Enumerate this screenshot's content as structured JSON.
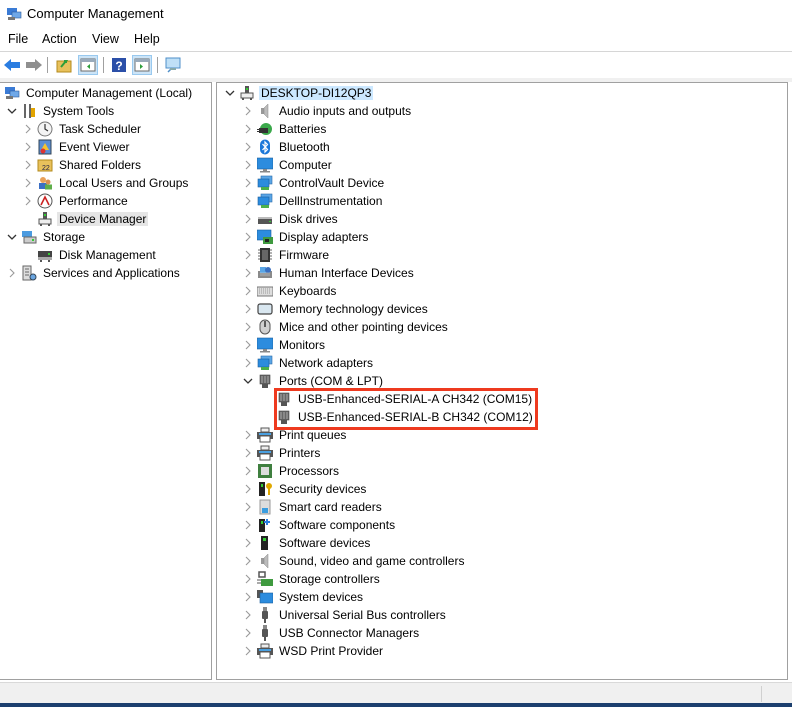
{
  "window": {
    "title": "Computer Management"
  },
  "menu": [
    "File",
    "Action",
    "View",
    "Help"
  ],
  "toolbar": [
    {
      "name": "back-icon"
    },
    {
      "name": "forward-icon"
    },
    {
      "name": "up-folder-icon"
    },
    {
      "name": "show-hide-console-tree-icon",
      "active": true
    },
    {
      "name": "help-icon"
    },
    {
      "name": "show-hide-action-pane-icon",
      "active": true
    },
    {
      "name": "connect-computer-icon"
    }
  ],
  "left_tree": [
    {
      "label": "Computer Management (Local)",
      "level": 0,
      "chevron": "",
      "icon": "computer-management-icon"
    },
    {
      "label": "System Tools",
      "level": 1,
      "chevron": "expanded",
      "icon": "system-tools-icon"
    },
    {
      "label": "Task Scheduler",
      "level": 2,
      "chevron": "collapsed",
      "icon": "task-scheduler-icon"
    },
    {
      "label": "Event Viewer",
      "level": 2,
      "chevron": "collapsed",
      "icon": "event-viewer-icon"
    },
    {
      "label": "Shared Folders",
      "level": 2,
      "chevron": "collapsed",
      "icon": "shared-folders-icon"
    },
    {
      "label": "Local Users and Groups",
      "level": 2,
      "chevron": "collapsed",
      "icon": "local-users-icon"
    },
    {
      "label": "Performance",
      "level": 2,
      "chevron": "collapsed",
      "icon": "performance-icon"
    },
    {
      "label": "Device Manager",
      "level": 2,
      "chevron": "",
      "icon": "device-manager-icon",
      "selected": true
    },
    {
      "label": "Storage",
      "level": 1,
      "chevron": "expanded",
      "icon": "storage-icon"
    },
    {
      "label": "Disk Management",
      "level": 2,
      "chevron": "",
      "icon": "disk-management-icon"
    },
    {
      "label": "Services and Applications",
      "level": 1,
      "chevron": "collapsed",
      "icon": "services-applications-icon"
    }
  ],
  "device_tree": {
    "root": "DESKTOP-DI12QP3",
    "categories": [
      {
        "label": "Audio inputs and outputs",
        "icon": "speaker-icon"
      },
      {
        "label": "Batteries",
        "icon": "battery-icon"
      },
      {
        "label": "Bluetooth",
        "icon": "bluetooth-icon"
      },
      {
        "label": "Computer",
        "icon": "monitor-icon"
      },
      {
        "label": "ControlVault Device",
        "icon": "network-icon"
      },
      {
        "label": "DellInstrumentation",
        "icon": "network-icon"
      },
      {
        "label": "Disk drives",
        "icon": "disk-drive-icon"
      },
      {
        "label": "Display adapters",
        "icon": "display-adapter-icon"
      },
      {
        "label": "Firmware",
        "icon": "firmware-icon"
      },
      {
        "label": "Human Interface Devices",
        "icon": "hid-icon"
      },
      {
        "label": "Keyboards",
        "icon": "keyboard-icon"
      },
      {
        "label": "Memory technology devices",
        "icon": "memory-icon"
      },
      {
        "label": "Mice and other pointing devices",
        "icon": "mouse-icon"
      },
      {
        "label": "Monitors",
        "icon": "monitor-icon"
      },
      {
        "label": "Network adapters",
        "icon": "network-icon"
      },
      {
        "label": "Ports (COM & LPT)",
        "icon": "port-icon",
        "expanded": true,
        "children": [
          {
            "label": "USB-Enhanced-SERIAL-A CH342 (COM15)",
            "icon": "port-icon"
          },
          {
            "label": "USB-Enhanced-SERIAL-B CH342 (COM12)",
            "icon": "port-icon"
          }
        ]
      },
      {
        "label": "Print queues",
        "icon": "printer-icon"
      },
      {
        "label": "Printers",
        "icon": "printer-icon"
      },
      {
        "label": "Processors",
        "icon": "processor-icon"
      },
      {
        "label": "Security devices",
        "icon": "security-icon"
      },
      {
        "label": "Smart card readers",
        "icon": "smart-card-icon"
      },
      {
        "label": "Software components",
        "icon": "software-components-icon"
      },
      {
        "label": "Software devices",
        "icon": "software-devices-icon"
      },
      {
        "label": "Sound, video and game controllers",
        "icon": "speaker-icon"
      },
      {
        "label": "Storage controllers",
        "icon": "storage-controller-icon"
      },
      {
        "label": "System devices",
        "icon": "system-devices-icon"
      },
      {
        "label": "Universal Serial Bus controllers",
        "icon": "usb-icon"
      },
      {
        "label": "USB Connector Managers",
        "icon": "usb-icon"
      },
      {
        "label": "WSD Print Provider",
        "icon": "printer-icon"
      }
    ]
  },
  "highlight_color": "#ee3a1f"
}
